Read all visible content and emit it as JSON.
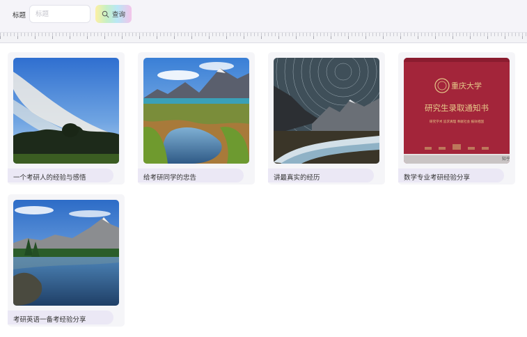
{
  "search": {
    "label": "标题",
    "placeholder": "标题",
    "value": "",
    "button_label": "查询",
    "button_icon": "search-icon"
  },
  "cards": [
    {
      "title": "一个考研人的经验与感悟",
      "image": "sky-and-trees-landscape"
    },
    {
      "title": "给考研同学的忠告",
      "image": "mountain-lake-meadow"
    },
    {
      "title": "讲最真实的经历",
      "image": "star-trails-mountain-river"
    },
    {
      "title": "数学专业考研经验分享",
      "image": "admission-notice-photo",
      "image_text": {
        "logo": "重庆大学",
        "headline": "研究生录取通知书",
        "subline": "研究学术 追求真理 奉献社会 报效祖国",
        "corner": "知乎"
      }
    },
    {
      "title": "考研英语一备考经验分享",
      "image": "alpine-lake-reflection"
    }
  ],
  "colors": {
    "topbar_bg": "#f5f4f9",
    "card_bg": "#f5f5f8",
    "title_pill_bg": "#ebe8f5",
    "notice_red": "#a3253a",
    "notice_gold": "#e6c98a"
  }
}
